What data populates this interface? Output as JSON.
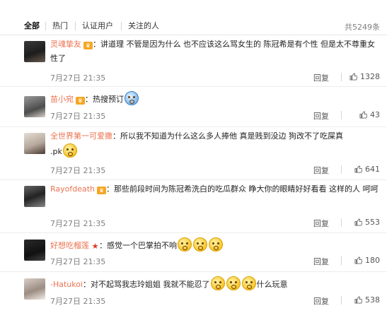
{
  "tabs": [
    {
      "label": "全部"
    },
    {
      "label": "热门"
    },
    {
      "label": "认证用户"
    },
    {
      "label": "关注的人"
    }
  ],
  "total_label": "共5249条",
  "comments": [
    {
      "username": "灵魂挚友",
      "badge": "vip",
      "text": "：讲道理 不管是因为什么 也不应该这么骂女生的  陈冠希是有个性 但是太不尊重女性了",
      "time": "7月27日 21:35",
      "reply_label": "回复",
      "likes": "1328"
    },
    {
      "username": "苗小宛",
      "badge": "vip",
      "text": "：热搜预订",
      "time": "7月27日 21:35",
      "reply_label": "回复",
      "likes": "43"
    },
    {
      "username": "全世界第一可爱撒",
      "badge": "none",
      "text": "：所以我不知道为什么这么多人捧他 真是贱到没边 狗改不了吃屎真",
      "text2": ".pk",
      "time": "7月27日 21:35",
      "reply_label": "回复",
      "likes": "641"
    },
    {
      "username": "Rayofdeath",
      "badge": "vip",
      "text": "：那些前段时间为陈冠希洗白的吃瓜群众 睁大你的眼睛好好看看 这样的人 呵呵",
      "time": "7月27日 21:35",
      "reply_label": "回复",
      "likes": "553"
    },
    {
      "username": "好想吃榴莲",
      "badge": "star",
      "text": "：感觉一个巴掌拍不响",
      "time": "7月27日 21:35",
      "reply_label": "回复",
      "likes": "180"
    },
    {
      "username": "-Hatukoi",
      "badge": "none",
      "text": "：对不起骂我志玲姐姐 我就不能忍了",
      "text2": "什么玩意",
      "time": "7月27日 21:35",
      "reply_label": "回复",
      "likes": "538"
    }
  ],
  "icons": {
    "thumb": "thumbs-up-icon",
    "vip": "vip-crown-icon",
    "star": "star-icon"
  },
  "colors": {
    "username": "#eb7350",
    "meta": "#808080"
  }
}
